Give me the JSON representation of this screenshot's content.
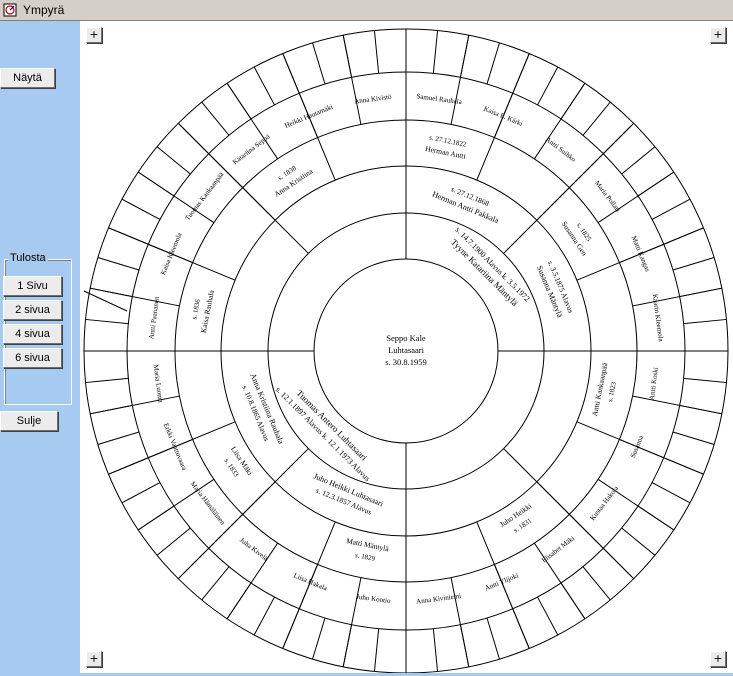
{
  "window": {
    "title": "Ympyrä",
    "icon": "chart-icon"
  },
  "sidebar": {
    "show_button": "Näytä",
    "print_group_label": "Tulosta",
    "print_buttons": [
      "1 Sivu",
      "2 sivua",
      "4 sivua",
      "6 sivua"
    ],
    "close_button": "Sulje"
  },
  "canvas": {
    "corner_buttons": [
      "+",
      "+",
      "+",
      "+"
    ]
  },
  "fan_chart": {
    "root": [
      "Seppo Kale",
      "Luhtasaari",
      "s. 30.8.1959"
    ],
    "generation_1": [
      {
        "name": "Tyyne Katariina Mäntylä",
        "info": "s. 14.7.1900 Alavus k. 3.5.1972"
      },
      {
        "name": "Tuomas Antero Luhtasaari",
        "info": "s. 12.1.1897 Alavus k. 12.1.1973 Alavus"
      }
    ],
    "generation_2": [
      {
        "name": "Herman Antti Pakkala",
        "info": "s. 27.12.1868"
      },
      {
        "name": "Susanna Mäntylä",
        "info": "s. 3.5.1875 Alavus"
      },
      {
        "name": "Juho Heikki Luhtasaari",
        "info": "s. 12.3.1857 Alavus"
      },
      {
        "name": "Anna Kristiina Rauhala",
        "info": "s. 10.8.1865 Alavus"
      }
    ],
    "generation_3": [
      {
        "name": "Herman Antti",
        "info": "s. 27.12.1822"
      },
      {
        "name": "Susanna Gen",
        "info": "s. 1825"
      },
      {
        "name": "Antti Kankaanpää",
        "info": "s. 1823"
      },
      {
        "name": "Juho Heikki",
        "info": "s. 1831"
      },
      {
        "name": "Matti Mäntylä",
        "info": "s. 1829"
      },
      {
        "name": "Liisa Mäki",
        "info": "s. 1833"
      },
      {
        "name": "Kaisa Rauhala",
        "info": "s. 1836"
      },
      {
        "name": "Anna Kristiina",
        "info": "s. 1838"
      }
    ],
    "outer_labels": [
      "Samuel Rauhala",
      "Kaisa E. Kärki",
      "Antti Suihko",
      "Maria Pollari",
      "Matti Kangas",
      "Kaarin Kleemola",
      "Antti Koski",
      "Susanna",
      "Kustaa Hakola",
      "Elisabet Mäki",
      "Antti Ylijoki",
      "Anna Kiviniemi",
      "Juho Kontio",
      "Liisa Hakala",
      "Juha Kivelä",
      "Maria Hämäläinen",
      "Erkki Vaattovaara",
      "Maria Luoma",
      "Antti Paananen",
      "Kaisa Kleemola",
      "Tuomas Kankaanpää",
      "Katariina Seppä",
      "Heikki Hautamäki",
      "Anna Kivistö"
    ]
  }
}
